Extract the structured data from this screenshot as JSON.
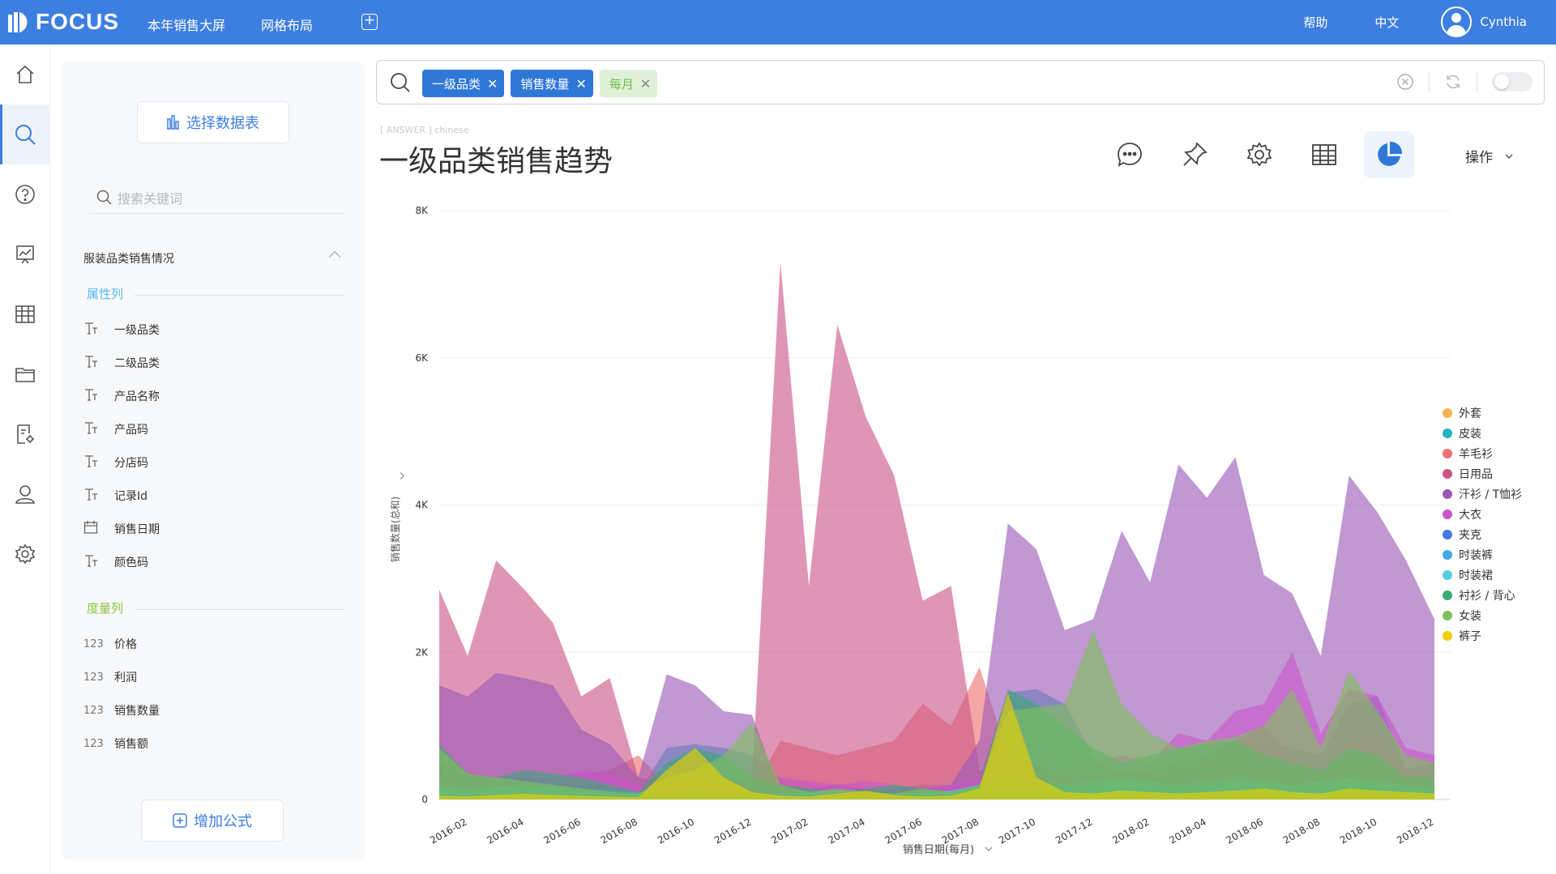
{
  "app": {
    "logo_text": "FOCUS",
    "nav": [
      "本年销售大屏",
      "网格布局"
    ],
    "add_tab_glyph": "+",
    "help": "帮助",
    "language": "中文",
    "user_name": "Cynthia"
  },
  "rail": {
    "items": [
      "home-icon",
      "search-icon",
      "help-icon",
      "dashboard-icon",
      "table-icon",
      "folder-icon",
      "report-settings-icon",
      "user-icon",
      "settings-icon"
    ],
    "active_index": 1
  },
  "panel": {
    "choose_table": "选择数据表",
    "search_placeholder": "搜索关键词",
    "table_name": "服装品类销售情况",
    "attr_title": "属性列",
    "measure_title": "度量列",
    "attributes": [
      {
        "type": "T",
        "name": "一级品类"
      },
      {
        "type": "T",
        "name": "二级品类"
      },
      {
        "type": "T",
        "name": "产品名称"
      },
      {
        "type": "T",
        "name": "产品码"
      },
      {
        "type": "T",
        "name": "分店码"
      },
      {
        "type": "T",
        "name": "记录Id"
      },
      {
        "type": "date",
        "name": "销售日期"
      },
      {
        "type": "T",
        "name": "颜色码"
      }
    ],
    "measures": [
      {
        "type": "123",
        "name": "价格"
      },
      {
        "type": "123",
        "name": "利润"
      },
      {
        "type": "123",
        "name": "销售数量"
      },
      {
        "type": "123",
        "name": "销售额"
      }
    ],
    "add_formula": "增加公式"
  },
  "search": {
    "tokens": [
      {
        "label": "一级品类",
        "style": "blue"
      },
      {
        "label": "销售数量",
        "style": "blue"
      },
      {
        "label": "每月",
        "style": "green"
      }
    ],
    "close_glyph": "✕"
  },
  "answer": {
    "tag": "[ ANSWER ] chinese",
    "title": "一级品类销售趋势",
    "operations": "操作"
  },
  "colors": {
    "brand": "#3d7fe0",
    "token_blue": "#2f78d8",
    "token_green_text": "#6fbf4a"
  },
  "chart_data": {
    "type": "area",
    "ylabel": "销售数量(总和)",
    "xlabel": "销售日期(每月)",
    "ylim": [
      0,
      8000
    ],
    "yticks": [
      "0",
      "2K",
      "4K",
      "6K",
      "8K"
    ],
    "grid": true,
    "legend_position": "right",
    "x": [
      "2016-01",
      "2016-02",
      "2016-03",
      "2016-04",
      "2016-05",
      "2016-06",
      "2016-07",
      "2016-08",
      "2016-09",
      "2016-10",
      "2016-11",
      "2016-12",
      "2017-01",
      "2017-02",
      "2017-03",
      "2017-04",
      "2017-05",
      "2017-06",
      "2017-07",
      "2017-08",
      "2017-09",
      "2017-10",
      "2017-11",
      "2017-12",
      "2018-01",
      "2018-02",
      "2018-03",
      "2018-04",
      "2018-05",
      "2018-06",
      "2018-07",
      "2018-08",
      "2018-09",
      "2018-10",
      "2018-11",
      "2018-12"
    ],
    "xtick_labels": [
      "2016-02",
      "2016-04",
      "2016-06",
      "2016-08",
      "2016-10",
      "2016-12",
      "2017-02",
      "2017-04",
      "2017-06",
      "2017-08",
      "2017-10",
      "2017-12",
      "2018-02",
      "2018-04",
      "2018-06",
      "2018-08",
      "2018-10",
      "2018-12"
    ],
    "series": [
      {
        "name": "外套",
        "color": "#f5b450",
        "values": [
          100,
          80,
          120,
          150,
          100,
          80,
          120,
          60,
          80,
          100,
          60,
          50,
          40,
          60,
          80,
          150,
          200,
          100,
          80,
          120,
          150,
          100,
          80,
          150,
          200,
          100,
          80,
          100,
          150,
          200,
          100,
          80,
          150,
          200,
          100,
          80
        ]
      },
      {
        "name": "皮装",
        "color": "#1fb5c0",
        "values": [
          500,
          300,
          250,
          300,
          250,
          200,
          150,
          100,
          700,
          750,
          700,
          600,
          300,
          200,
          150,
          100,
          150,
          200,
          200,
          300,
          1450,
          1500,
          1300,
          600,
          200,
          400,
          500,
          600,
          800,
          800,
          700,
          600,
          1300,
          1400,
          400,
          500
        ]
      },
      {
        "name": "羊毛衫",
        "color": "#ee7070",
        "values": [
          200,
          150,
          200,
          250,
          300,
          350,
          400,
          600,
          200,
          150,
          100,
          100,
          800,
          700,
          600,
          700,
          800,
          1300,
          1000,
          1800,
          600,
          400,
          300,
          200,
          400,
          300,
          400,
          500,
          800,
          1000,
          600,
          400,
          800,
          900,
          400,
          300
        ]
      },
      {
        "name": "日用品",
        "color": "#cc5588",
        "values": [
          2850,
          1950,
          3250,
          2850,
          2400,
          1400,
          1650,
          300,
          200,
          300,
          200,
          300,
          7300,
          2900,
          6450,
          5200,
          4400,
          2700,
          2900,
          400,
          300,
          200,
          300,
          200,
          300,
          400,
          300,
          400,
          300,
          400,
          300,
          400,
          300,
          400,
          300,
          200
        ]
      },
      {
        "name": "汗衫 / T恤衫",
        "color": "#9b59b6",
        "values": [
          1550,
          1400,
          1720,
          1650,
          1550,
          950,
          750,
          300,
          1700,
          1550,
          1200,
          1150,
          100,
          150,
          200,
          150,
          100,
          150,
          200,
          800,
          3750,
          3400,
          2300,
          2450,
          3650,
          2950,
          4550,
          4100,
          4650,
          3050,
          2800,
          1950,
          4400,
          3900,
          3250,
          2450
        ]
      },
      {
        "name": "大衣",
        "color": "#cc55cc",
        "values": [
          300,
          250,
          300,
          350,
          300,
          400,
          350,
          200,
          150,
          200,
          150,
          100,
          300,
          250,
          200,
          250,
          200,
          150,
          200,
          300,
          600,
          500,
          400,
          500,
          600,
          500,
          900,
          800,
          1200,
          1300,
          2000,
          900,
          1500,
          1400,
          700,
          600
        ]
      },
      {
        "name": "夹克",
        "color": "#4477dd",
        "values": [
          100,
          80,
          100,
          120,
          100,
          80,
          60,
          50,
          60,
          80,
          60,
          50,
          40,
          60,
          80,
          60,
          50,
          60,
          80,
          100,
          150,
          120,
          100,
          120,
          150,
          120,
          100,
          120,
          150,
          120,
          100,
          120,
          150,
          120,
          100,
          80
        ]
      },
      {
        "name": "时装裤",
        "color": "#45a8e8",
        "values": [
          150,
          120,
          150,
          180,
          150,
          120,
          100,
          80,
          100,
          120,
          100,
          80,
          60,
          80,
          100,
          80,
          60,
          80,
          100,
          150,
          200,
          180,
          150,
          180,
          200,
          180,
          150,
          180,
          200,
          180,
          150,
          180,
          200,
          180,
          150,
          120
        ]
      },
      {
        "name": "时装裙",
        "color": "#55cfe0",
        "values": [
          200,
          150,
          180,
          200,
          180,
          150,
          120,
          100,
          120,
          150,
          120,
          100,
          80,
          100,
          120,
          100,
          80,
          100,
          120,
          200,
          300,
          250,
          200,
          250,
          300,
          250,
          200,
          250,
          300,
          250,
          200,
          250,
          300,
          250,
          200,
          150
        ]
      },
      {
        "name": "衬衫 / 背心",
        "color": "#3aaa77",
        "values": [
          750,
          350,
          300,
          400,
          350,
          300,
          200,
          100,
          500,
          700,
          600,
          300,
          200,
          150,
          100,
          150,
          200,
          150,
          100,
          200,
          1500,
          1300,
          1000,
          700,
          500,
          600,
          700,
          750,
          800,
          600,
          500,
          400,
          700,
          600,
          300,
          300
        ]
      },
      {
        "name": "女装",
        "color": "#7ec05a",
        "values": [
          700,
          350,
          300,
          250,
          200,
          150,
          100,
          80,
          300,
          400,
          600,
          1050,
          200,
          100,
          150,
          100,
          80,
          150,
          100,
          200,
          1200,
          1250,
          1300,
          2300,
          1300,
          900,
          700,
          800,
          850,
          1000,
          1500,
          700,
          1750,
          1200,
          600,
          500
        ]
      },
      {
        "name": "裤子",
        "color": "#f0d000",
        "values": [
          50,
          40,
          60,
          80,
          60,
          50,
          40,
          30,
          400,
          700,
          300,
          100,
          50,
          40,
          80,
          120,
          60,
          40,
          50,
          150,
          1450,
          300,
          100,
          80,
          120,
          100,
          80,
          100,
          120,
          150,
          100,
          80,
          150,
          120,
          100,
          80
        ]
      }
    ]
  }
}
